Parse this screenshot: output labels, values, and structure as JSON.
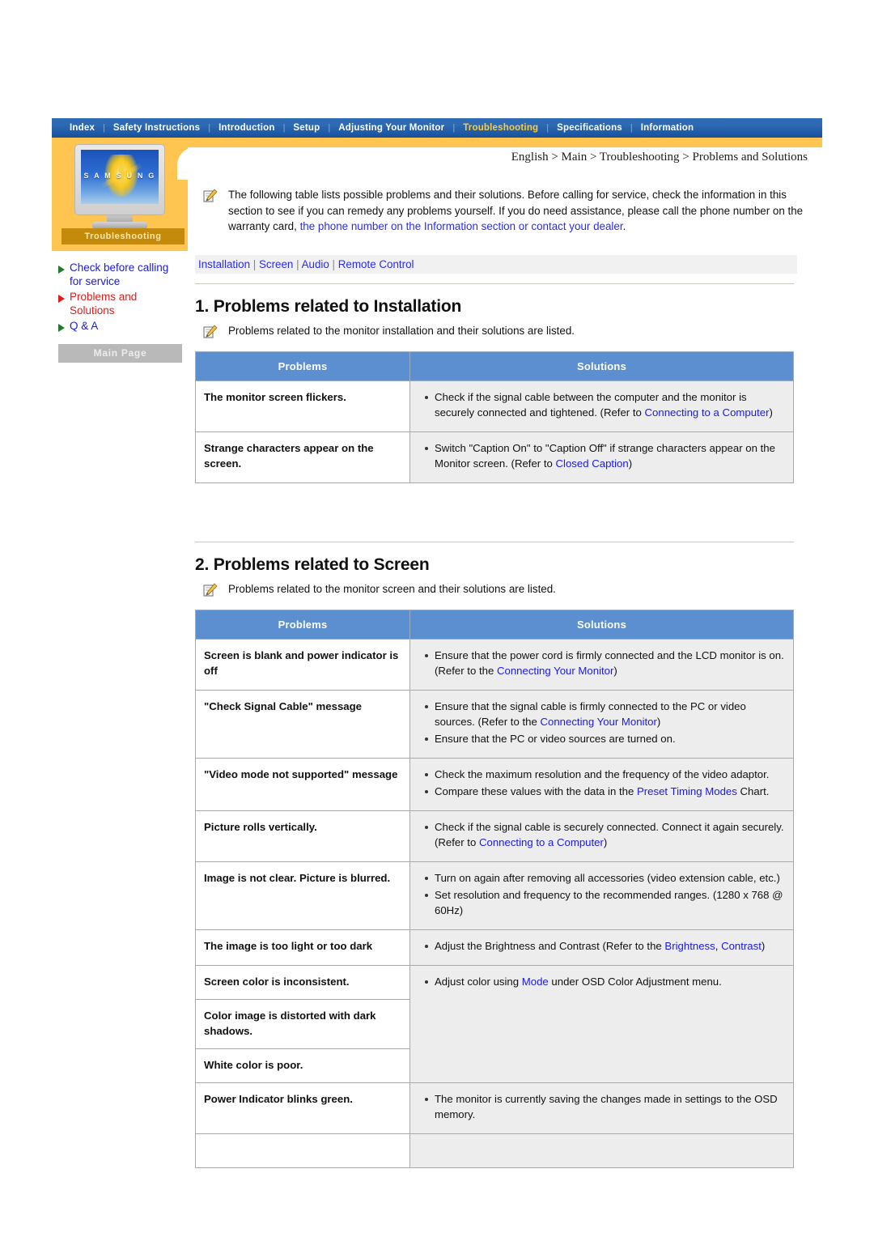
{
  "nav": {
    "items": [
      {
        "label": "Index",
        "active": false
      },
      {
        "label": "Safety Instructions",
        "active": false
      },
      {
        "label": "Introduction",
        "active": false
      },
      {
        "label": "Setup",
        "active": false
      },
      {
        "label": "Adjusting Your Monitor",
        "active": false
      },
      {
        "label": "Troubleshooting",
        "active": true
      },
      {
        "label": "Specifications",
        "active": false
      },
      {
        "label": "Information",
        "active": false
      }
    ],
    "separator": "|",
    "active_color": "#ffcc33",
    "bar_color": "#2d6ab3"
  },
  "sidebar": {
    "monitor_logo_text": "S A M S U N G",
    "section_caption": "Troubleshooting",
    "links": [
      {
        "label": "Check before calling for service",
        "current": false
      },
      {
        "label": "Problems and Solutions",
        "current": true
      },
      {
        "label": "Q & A",
        "current": false
      }
    ],
    "main_page_button": "Main Page",
    "accent_yellow": "#ffc550",
    "caption_bg": "#c48a0c",
    "link_color": "#1a1ad8",
    "current_link_color": "#e01b1b"
  },
  "breadcrumb": "English > Main > Troubleshooting > Problems and Solutions",
  "intro": {
    "part1": "The following table lists possible problems and their solutions. Before calling for service, check the information in this section to see if you can remedy any problems yourself. If you do need assistance, please call the phone number on the warranty card, ",
    "link": "the phone number on the Information section or contact your dealer",
    "part2": "."
  },
  "subnav": {
    "items": [
      "Installation",
      "Screen",
      "Audio",
      "Remote Control"
    ],
    "separator": "|"
  },
  "sections": [
    {
      "title": "1. Problems related to Installation",
      "subtitle": "Problems related to the monitor installation and their solutions are listed.",
      "columns": [
        "Problems",
        "Solutions"
      ],
      "rows": [
        {
          "problem": "The monitor screen flickers.",
          "solutions": [
            {
              "segments": [
                {
                  "t": "Check if the signal cable between the computer and the monitor is securely connected and tightened. (Refer to ",
                  "link": false
                },
                {
                  "t": "Connecting to a Computer",
                  "link": true
                },
                {
                  "t": ")",
                  "link": false
                }
              ]
            }
          ]
        },
        {
          "problem": "Strange characters appear on the screen.",
          "solutions": [
            {
              "segments": [
                {
                  "t": "Switch \"Caption On\" to \"Caption Off\" if strange characters appear on the Monitor screen. (Refer to ",
                  "link": false
                },
                {
                  "t": "Closed Caption",
                  "link": true
                },
                {
                  "t": ")",
                  "link": false
                }
              ]
            }
          ]
        }
      ]
    },
    {
      "title": "2. Problems related to Screen",
      "subtitle": "Problems related to the monitor screen and their solutions are listed.",
      "columns": [
        "Problems",
        "Solutions"
      ],
      "rows": [
        {
          "problem": "Screen is blank and power indicator is off",
          "solutions": [
            {
              "segments": [
                {
                  "t": "Ensure that the power cord is firmly connected and the LCD monitor is on. (Refer to the ",
                  "link": false
                },
                {
                  "t": "Connecting Your Monitor",
                  "link": true
                },
                {
                  "t": ")",
                  "link": false
                }
              ]
            }
          ]
        },
        {
          "problem": "\"Check Signal Cable\" message",
          "solutions": [
            {
              "segments": [
                {
                  "t": "Ensure that the signal cable is firmly connected to the PC or video sources. (Refer to the ",
                  "link": false
                },
                {
                  "t": "Connecting Your Monitor",
                  "link": true
                },
                {
                  "t": ")",
                  "link": false
                }
              ]
            },
            {
              "segments": [
                {
                  "t": "Ensure that the PC or video sources are turned on.",
                  "link": false
                }
              ]
            }
          ]
        },
        {
          "problem": "\"Video mode not supported\" message",
          "solutions": [
            {
              "segments": [
                {
                  "t": "Check the maximum resolution and the frequency of the video adaptor.",
                  "link": false
                }
              ]
            },
            {
              "segments": [
                {
                  "t": "Compare these values with the data in the ",
                  "link": false
                },
                {
                  "t": "Preset Timing Modes",
                  "link": true
                },
                {
                  "t": " Chart.",
                  "link": false
                }
              ]
            }
          ]
        },
        {
          "problem": "Picture rolls vertically.",
          "solutions": [
            {
              "segments": [
                {
                  "t": "Check if the signal cable is securely connected. Connect it again securely.(Refer to ",
                  "link": false
                },
                {
                  "t": "Connecting to a Computer",
                  "link": true
                },
                {
                  "t": ")",
                  "link": false
                }
              ]
            }
          ]
        },
        {
          "problem": "Image is not clear. Picture is blurred.",
          "solutions": [
            {
              "segments": [
                {
                  "t": "Turn on again after removing all accessories (video extension cable, etc.)",
                  "link": false
                }
              ]
            },
            {
              "segments": [
                {
                  "t": "Set resolution and frequency to the recommended ranges. (1280 x 768 @ 60Hz)",
                  "link": false
                }
              ]
            }
          ]
        },
        {
          "problem": "The image is too light or too dark",
          "solutions": [
            {
              "segments": [
                {
                  "t": "Adjust the Brightness and Contrast (Refer to the ",
                  "link": false
                },
                {
                  "t": "Brightness",
                  "link": true
                },
                {
                  "t": ", ",
                  "link": false
                },
                {
                  "t": "Contrast",
                  "link": true
                },
                {
                  "t": ")",
                  "link": false
                }
              ]
            }
          ]
        },
        {
          "problem": "Screen color is inconsistent.",
          "merged_group": true,
          "solutions": [
            {
              "segments": [
                {
                  "t": "Adjust color using ",
                  "link": false
                },
                {
                  "t": "Mode",
                  "link": true
                },
                {
                  "t": " under OSD Color Adjustment menu.",
                  "link": false
                }
              ]
            }
          ]
        },
        {
          "problem": "Color image is distorted with dark shadows.",
          "merged_continuation": true,
          "solutions": []
        },
        {
          "problem": "White color is poor.",
          "merged_continuation": true,
          "solutions": []
        },
        {
          "problem": "Power Indicator blinks green.",
          "solutions": [
            {
              "segments": [
                {
                  "t": "The monitor is currently saving the changes made in settings to the OSD memory.",
                  "link": false
                }
              ]
            }
          ]
        },
        {
          "problem": "",
          "solutions": []
        }
      ]
    }
  ],
  "colors": {
    "table_header_bg": "#5b8fd0",
    "solution_bg": "#ededed",
    "link_blue": "#2a2aff"
  }
}
